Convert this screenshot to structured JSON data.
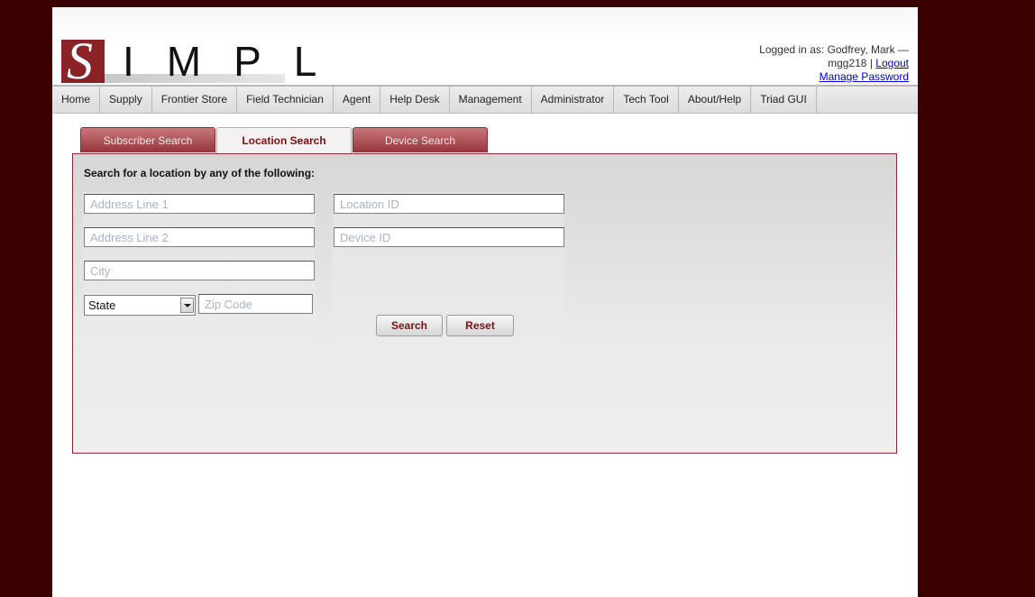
{
  "logo": {
    "letters": "IMPL",
    "initial": "S"
  },
  "user": {
    "logged_in_label": "Logged in as: Godfrey, Mark —",
    "username": "mgg218",
    "separator": "|",
    "logout": "Logout",
    "manage_password": "Manage Password"
  },
  "nav": {
    "items": [
      "Home",
      "Supply",
      "Frontier Store",
      "Field Technician",
      "Agent",
      "Help Desk",
      "Management",
      "Administrator",
      "Tech Tool",
      "About/Help",
      "Triad GUI"
    ]
  },
  "tabs": [
    {
      "label": "Subscriber Search",
      "active": false
    },
    {
      "label": "Location Search",
      "active": true
    },
    {
      "label": "Device Search",
      "active": false
    }
  ],
  "form": {
    "instructions": "Search for a location by any of the following:",
    "address1": {
      "placeholder": "Address Line 1",
      "value": ""
    },
    "address2": {
      "placeholder": "Address Line 2",
      "value": ""
    },
    "city": {
      "placeholder": "City",
      "value": ""
    },
    "state": {
      "selected": "State"
    },
    "zip": {
      "placeholder": "Zip Code",
      "value": ""
    },
    "location_id": {
      "placeholder": "Location ID",
      "value": ""
    },
    "device_id": {
      "placeholder": "Device ID",
      "value": ""
    },
    "search_label": "Search",
    "reset_label": "Reset"
  },
  "colors": {
    "background": "#3a0000",
    "brand": "#8b2326",
    "link": "#0000cc"
  }
}
